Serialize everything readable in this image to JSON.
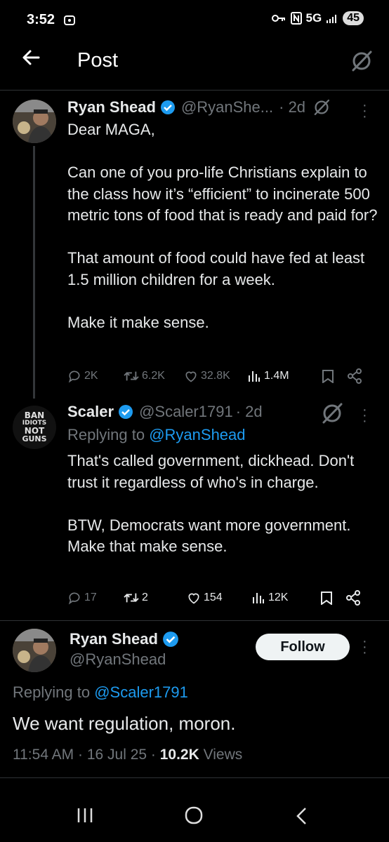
{
  "status_bar": {
    "time": "3:52",
    "network": "5G",
    "battery": "45"
  },
  "header": {
    "title": "Post"
  },
  "thread": [
    {
      "name": "Ryan Shead",
      "handle": "@RyanShe...",
      "time": "· 2d",
      "text": "Dear MAGA,\n\nCan one of you pro-life Christians explain to the class how it’s “efficient” to incinerate 500 metric tons of food that is ready and paid for?\n\nThat amount of food could have fed at least 1.5 million children for a week.\n\nMake it make sense.",
      "replies": "2K",
      "reposts": "6.2K",
      "likes": "32.8K",
      "views": "1.4M"
    },
    {
      "name": "Scaler",
      "handle": "@Scaler1791",
      "time": "· 2d",
      "replying_label": "Replying to",
      "replying_to": "@RyanShead",
      "avatar_text": [
        "BAN",
        "IDIOTS",
        "NOT",
        "GUNS"
      ],
      "text": "That's called government, dickhead. Don't trust it regardless of who's in charge.\n\nBTW, Democrats want more government. Make that make sense.",
      "replies": "17",
      "reposts": "2",
      "likes": "154",
      "views": "12K"
    }
  ],
  "main_post": {
    "name": "Ryan Shead",
    "handle": "@RyanShead",
    "follow_label": "Follow",
    "replying_label": "Replying to",
    "replying_to": "@Scaler1791",
    "text": "We want regulation, moron.",
    "timestamp": "11:54 AM · 16 Jul 25 · ",
    "views_count": "10.2K",
    "views_label": " Views"
  },
  "colors": {
    "accent": "#1d9bf0",
    "muted": "#71767b",
    "text": "#e7e9ea",
    "background": "#000000"
  }
}
